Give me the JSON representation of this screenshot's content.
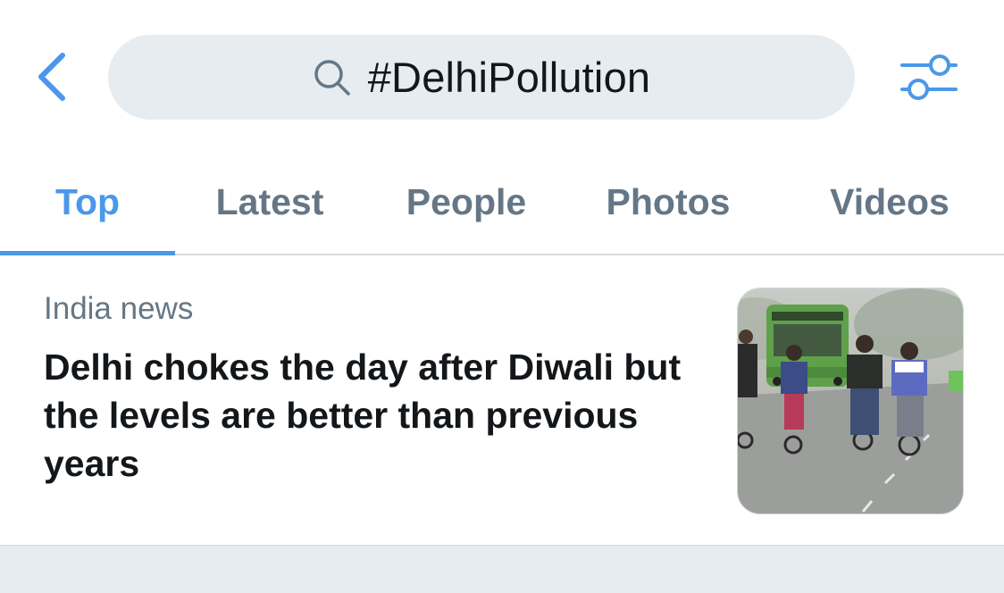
{
  "search": {
    "query": "#DelhiPollution"
  },
  "tabs": [
    {
      "label": "Top",
      "active": true
    },
    {
      "label": "Latest",
      "active": false
    },
    {
      "label": "People",
      "active": false
    },
    {
      "label": "Photos",
      "active": false
    },
    {
      "label": "Videos",
      "active": false
    }
  ],
  "news": {
    "category": "India news",
    "headline": "Delhi chokes the day after Diwali but the levels are better than previous years"
  },
  "icons": {
    "back": "chevron-left-icon",
    "search": "search-icon",
    "filter": "filter-sliders-icon"
  },
  "colors": {
    "accent": "#4a98e9",
    "search_background": "#e6ecf0",
    "secondary_text": "#657786",
    "primary_text": "#14171a"
  }
}
